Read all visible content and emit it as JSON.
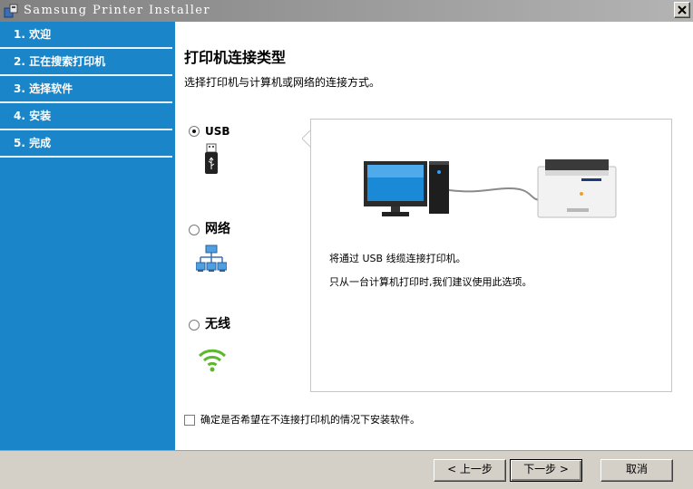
{
  "window": {
    "title": "Samsung Printer Installer"
  },
  "sidebar": {
    "steps": [
      {
        "label": "1. 欢迎"
      },
      {
        "label": "2. 正在搜索打印机"
      },
      {
        "label": "3. 选择软件"
      },
      {
        "label": "4. 安装"
      },
      {
        "label": "5. 完成"
      }
    ]
  },
  "main": {
    "title": "打印机连接类型",
    "subtitle": "选择打印机与计算机或网络的连接方式。",
    "options": [
      {
        "label": "USB",
        "icon": "usb-icon",
        "selected": true
      },
      {
        "label": "网络",
        "icon": "network-icon",
        "selected": false
      },
      {
        "label": "无线",
        "icon": "wifi-icon",
        "selected": false
      }
    ],
    "info_panel": {
      "line1": "将通过 USB 线缆连接打印机。",
      "line2": "只从一台计算机打印时,我们建议使用此选项。"
    },
    "no_connect_checkbox": {
      "label": "确定是否希望在不连接打印机的情况下安装软件。",
      "checked": false
    }
  },
  "buttons": {
    "back": "< 上一步",
    "next": "下一步 >",
    "cancel": "取消"
  }
}
